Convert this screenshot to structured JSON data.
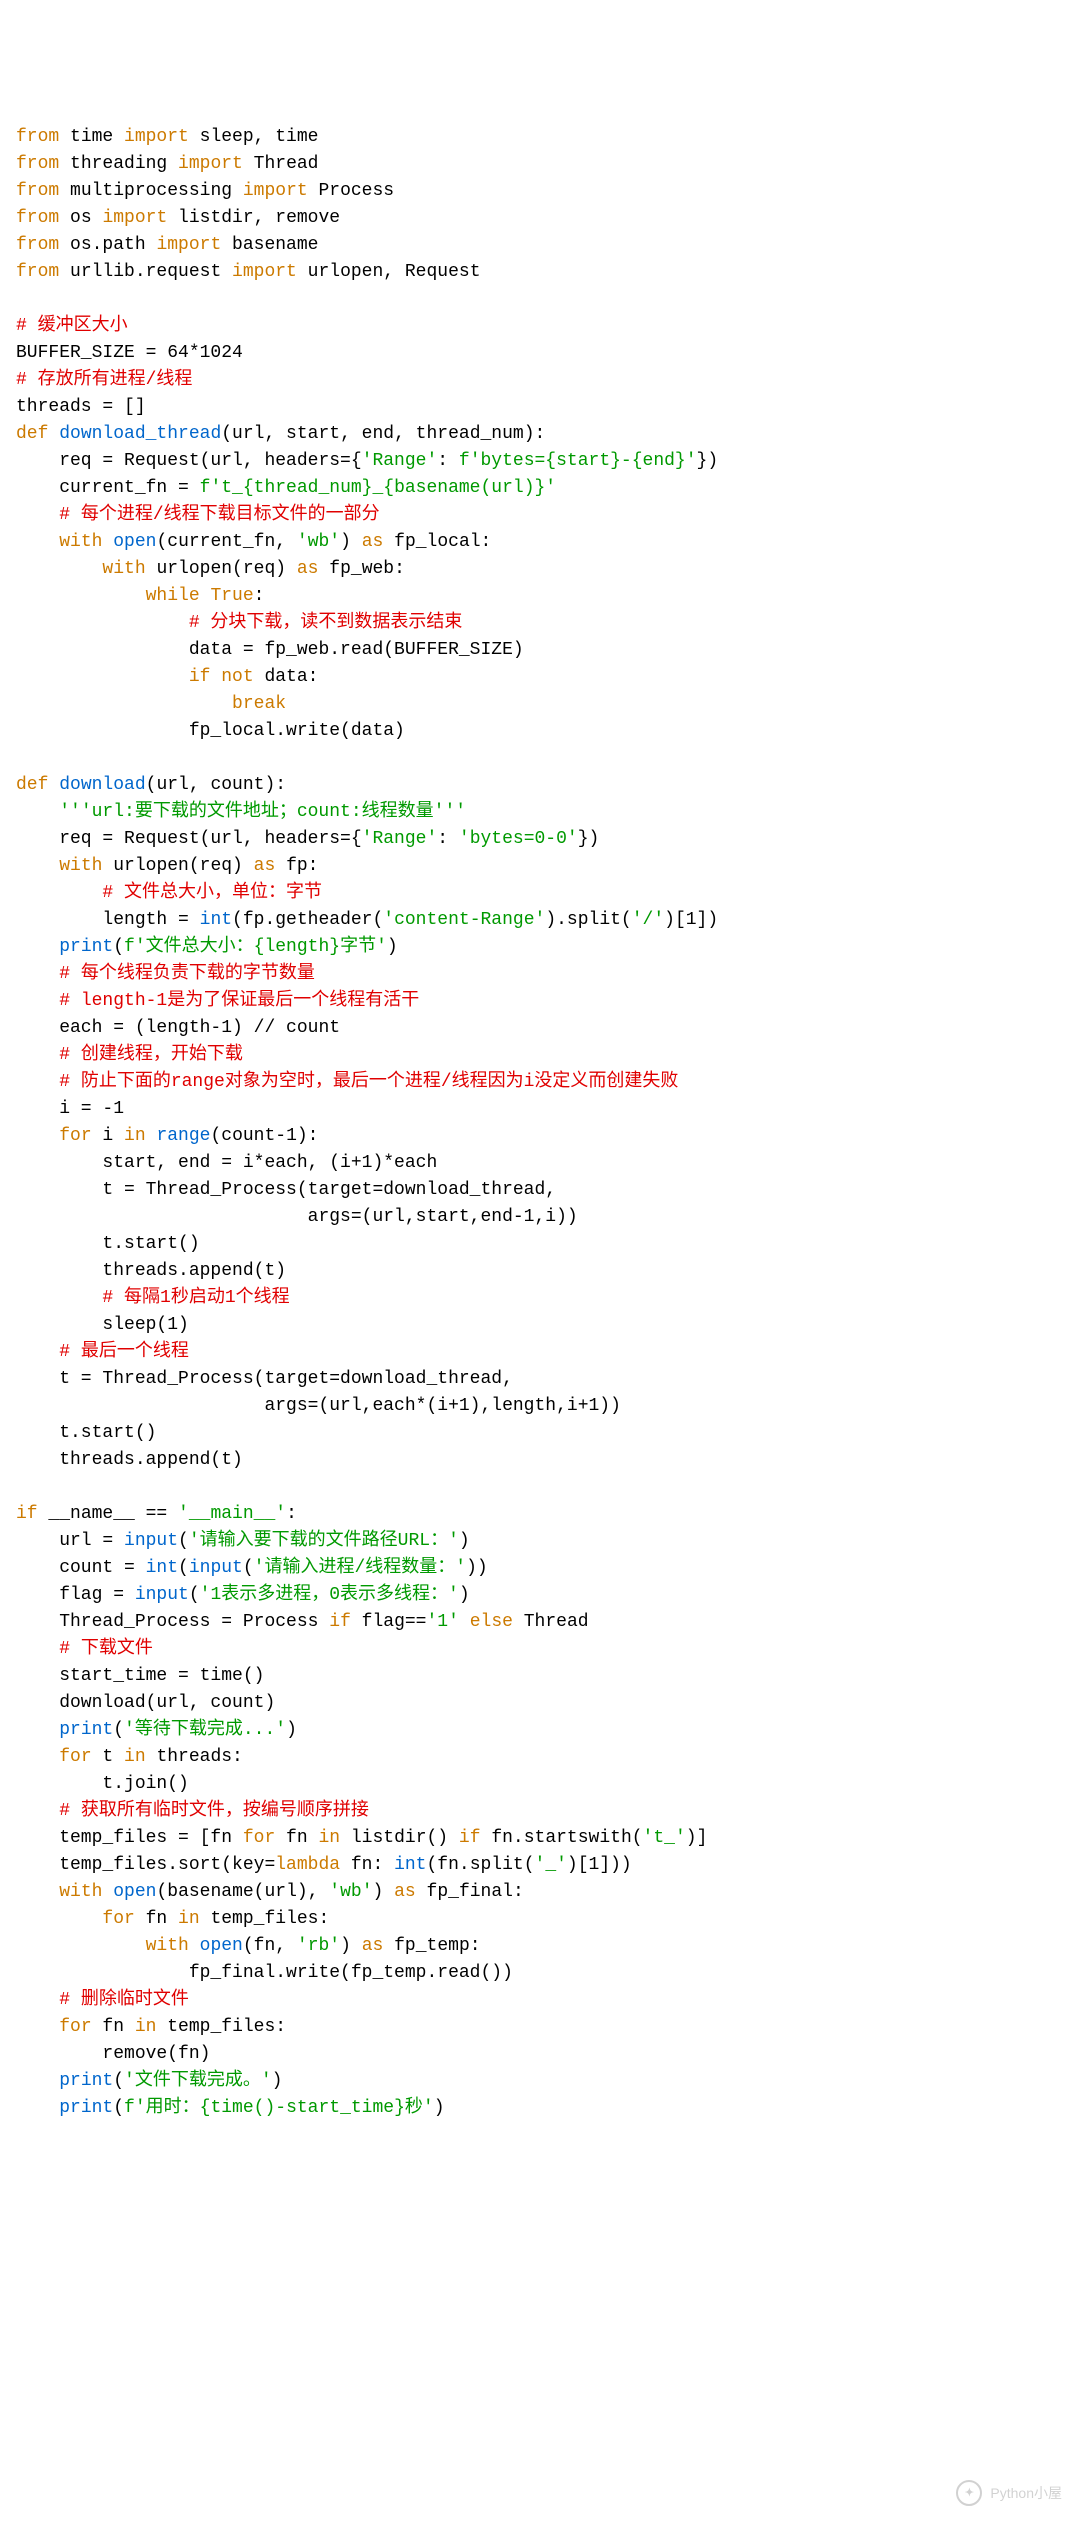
{
  "watermark": {
    "text": "Python小屋"
  },
  "code": {
    "tokens": [
      [
        [
          "kw",
          "from"
        ],
        [
          "dark",
          " time "
        ],
        [
          "kw",
          "import"
        ],
        [
          "dark",
          " sleep, time"
        ]
      ],
      [
        [
          "kw",
          "from"
        ],
        [
          "dark",
          " threading "
        ],
        [
          "kw",
          "import"
        ],
        [
          "dark",
          " Thread"
        ]
      ],
      [
        [
          "kw",
          "from"
        ],
        [
          "dark",
          " multiprocessing "
        ],
        [
          "kw",
          "import"
        ],
        [
          "dark",
          " Process"
        ]
      ],
      [
        [
          "kw",
          "from"
        ],
        [
          "dark",
          " os "
        ],
        [
          "kw",
          "import"
        ],
        [
          "dark",
          " listdir, remove"
        ]
      ],
      [
        [
          "kw",
          "from"
        ],
        [
          "dark",
          " os.path "
        ],
        [
          "kw",
          "import"
        ],
        [
          "dark",
          " basename"
        ]
      ],
      [
        [
          "kw",
          "from"
        ],
        [
          "dark",
          " urllib.request "
        ],
        [
          "kw",
          "import"
        ],
        [
          "dark",
          " urlopen, Request"
        ]
      ],
      [],
      [
        [
          "cmt",
          "# 缓冲区大小"
        ]
      ],
      [
        [
          "dark",
          "BUFFER_SIZE = 64*1024"
        ]
      ],
      [
        [
          "cmt",
          "# 存放所有进程/线程"
        ]
      ],
      [
        [
          "dark",
          "threads = []"
        ]
      ],
      [
        [
          "kw",
          "def "
        ],
        [
          "fn",
          "download_thread"
        ],
        [
          "dark",
          "(url, start, end, thread_num):"
        ]
      ],
      [
        [
          "dark",
          "    req = Request(url, headers={"
        ],
        [
          "str",
          "'Range'"
        ],
        [
          "dark",
          ": "
        ],
        [
          "str",
          "f'bytes={start}-{end}'"
        ],
        [
          "dark",
          "})"
        ]
      ],
      [
        [
          "dark",
          "    current_fn = "
        ],
        [
          "str",
          "f't_{thread_num}_{basename(url)}'"
        ]
      ],
      [
        [
          "dark",
          "    "
        ],
        [
          "cmt",
          "# 每个进程/线程下载目标文件的一部分"
        ]
      ],
      [
        [
          "dark",
          "    "
        ],
        [
          "kw",
          "with"
        ],
        [
          "dark",
          " "
        ],
        [
          "fn",
          "open"
        ],
        [
          "dark",
          "(current_fn, "
        ],
        [
          "str",
          "'wb'"
        ],
        [
          "dark",
          ") "
        ],
        [
          "kw",
          "as"
        ],
        [
          "dark",
          " fp_local:"
        ]
      ],
      [
        [
          "dark",
          "        "
        ],
        [
          "kw",
          "with"
        ],
        [
          "dark",
          " urlopen(req) "
        ],
        [
          "kw",
          "as"
        ],
        [
          "dark",
          " fp_web:"
        ]
      ],
      [
        [
          "dark",
          "            "
        ],
        [
          "kw",
          "while"
        ],
        [
          "dark",
          " "
        ],
        [
          "kw",
          "True"
        ],
        [
          "dark",
          ":"
        ]
      ],
      [
        [
          "dark",
          "                "
        ],
        [
          "cmt",
          "# 分块下载，读不到数据表示结束"
        ]
      ],
      [
        [
          "dark",
          "                data = fp_web.read(BUFFER_SIZE)"
        ]
      ],
      [
        [
          "dark",
          "                "
        ],
        [
          "kw",
          "if"
        ],
        [
          "dark",
          " "
        ],
        [
          "kw",
          "not"
        ],
        [
          "dark",
          " data:"
        ]
      ],
      [
        [
          "dark",
          "                    "
        ],
        [
          "kw",
          "break"
        ]
      ],
      [
        [
          "dark",
          "                fp_local.write(data)"
        ]
      ],
      [],
      [
        [
          "kw",
          "def "
        ],
        [
          "fn",
          "download"
        ],
        [
          "dark",
          "(url, count):"
        ]
      ],
      [
        [
          "dark",
          "    "
        ],
        [
          "str",
          "'''url:要下载的文件地址；count:线程数量'''"
        ]
      ],
      [
        [
          "dark",
          "    req = Request(url, headers={"
        ],
        [
          "str",
          "'Range'"
        ],
        [
          "dark",
          ": "
        ],
        [
          "str",
          "'bytes=0-0'"
        ],
        [
          "dark",
          "})"
        ]
      ],
      [
        [
          "dark",
          "    "
        ],
        [
          "kw",
          "with"
        ],
        [
          "dark",
          " urlopen(req) "
        ],
        [
          "kw",
          "as"
        ],
        [
          "dark",
          " fp:"
        ]
      ],
      [
        [
          "dark",
          "        "
        ],
        [
          "cmt",
          "# 文件总大小，单位：字节"
        ]
      ],
      [
        [
          "dark",
          "        length = "
        ],
        [
          "fn",
          "int"
        ],
        [
          "dark",
          "(fp.getheader("
        ],
        [
          "str",
          "'content-Range'"
        ],
        [
          "dark",
          ").split("
        ],
        [
          "str",
          "'/'"
        ],
        [
          "dark",
          ")[1])"
        ]
      ],
      [
        [
          "dark",
          "    "
        ],
        [
          "fn",
          "print"
        ],
        [
          "dark",
          "("
        ],
        [
          "str",
          "f'文件总大小：{length}字节'"
        ],
        [
          "dark",
          ")"
        ]
      ],
      [
        [
          "dark",
          "    "
        ],
        [
          "cmt",
          "# 每个线程负责下载的字节数量"
        ]
      ],
      [
        [
          "dark",
          "    "
        ],
        [
          "cmt",
          "# length-1是为了保证最后一个线程有活干"
        ]
      ],
      [
        [
          "dark",
          "    each = (length-1) // count"
        ]
      ],
      [
        [
          "dark",
          "    "
        ],
        [
          "cmt",
          "# 创建线程，开始下载"
        ]
      ],
      [
        [
          "dark",
          "    "
        ],
        [
          "cmt",
          "# 防止下面的range对象为空时，最后一个进程/线程因为i没定义而创建失败"
        ]
      ],
      [
        [
          "dark",
          "    i = -1"
        ]
      ],
      [
        [
          "dark",
          "    "
        ],
        [
          "kw",
          "for"
        ],
        [
          "dark",
          " i "
        ],
        [
          "kw",
          "in"
        ],
        [
          "dark",
          " "
        ],
        [
          "fn",
          "range"
        ],
        [
          "dark",
          "(count-1):"
        ]
      ],
      [
        [
          "dark",
          "        start, end = i*each, (i+1)*each"
        ]
      ],
      [
        [
          "dark",
          "        t = Thread_Process(target=download_thread,"
        ]
      ],
      [
        [
          "dark",
          "                           args=(url,start,end-1,i))"
        ]
      ],
      [
        [
          "dark",
          "        t.start()"
        ]
      ],
      [
        [
          "dark",
          "        threads.append(t)"
        ]
      ],
      [
        [
          "dark",
          "        "
        ],
        [
          "cmt",
          "# 每隔1秒启动1个线程"
        ]
      ],
      [
        [
          "dark",
          "        sleep(1)"
        ]
      ],
      [
        [
          "dark",
          "    "
        ],
        [
          "cmt",
          "# 最后一个线程"
        ]
      ],
      [
        [
          "dark",
          "    t = Thread_Process(target=download_thread,"
        ]
      ],
      [
        [
          "dark",
          "                       args=(url,each*(i+1),length,i+1))"
        ]
      ],
      [
        [
          "dark",
          "    t.start()"
        ]
      ],
      [
        [
          "dark",
          "    threads.append(t)"
        ]
      ],
      [],
      [
        [
          "kw",
          "if"
        ],
        [
          "dark",
          " __name__ == "
        ],
        [
          "str",
          "'__main__'"
        ],
        [
          "dark",
          ":"
        ]
      ],
      [
        [
          "dark",
          "    url = "
        ],
        [
          "fn",
          "input"
        ],
        [
          "dark",
          "("
        ],
        [
          "str",
          "'请输入要下载的文件路径URL：'"
        ],
        [
          "dark",
          ")"
        ]
      ],
      [
        [
          "dark",
          "    count = "
        ],
        [
          "fn",
          "int"
        ],
        [
          "dark",
          "("
        ],
        [
          "fn",
          "input"
        ],
        [
          "dark",
          "("
        ],
        [
          "str",
          "'请输入进程/线程数量：'"
        ],
        [
          "dark",
          "))"
        ]
      ],
      [
        [
          "dark",
          "    flag = "
        ],
        [
          "fn",
          "input"
        ],
        [
          "dark",
          "("
        ],
        [
          "str",
          "'1表示多进程，0表示多线程：'"
        ],
        [
          "dark",
          ")"
        ]
      ],
      [
        [
          "dark",
          "    Thread_Process = Process "
        ],
        [
          "kw",
          "if"
        ],
        [
          "dark",
          " flag=="
        ],
        [
          "str",
          "'1'"
        ],
        [
          "dark",
          " "
        ],
        [
          "kw",
          "else"
        ],
        [
          "dark",
          " Thread"
        ]
      ],
      [
        [
          "dark",
          "    "
        ],
        [
          "cmt",
          "# 下载文件"
        ]
      ],
      [
        [
          "dark",
          "    start_time = time()"
        ]
      ],
      [
        [
          "dark",
          "    download(url, count)"
        ]
      ],
      [
        [
          "dark",
          "    "
        ],
        [
          "fn",
          "print"
        ],
        [
          "dark",
          "("
        ],
        [
          "str",
          "'等待下载完成...'"
        ],
        [
          "dark",
          ")"
        ]
      ],
      [
        [
          "dark",
          "    "
        ],
        [
          "kw",
          "for"
        ],
        [
          "dark",
          " t "
        ],
        [
          "kw",
          "in"
        ],
        [
          "dark",
          " threads:"
        ]
      ],
      [
        [
          "dark",
          "        t.join()"
        ]
      ],
      [
        [
          "dark",
          "    "
        ],
        [
          "cmt",
          "# 获取所有临时文件，按编号顺序拼接"
        ]
      ],
      [
        [
          "dark",
          "    temp_files = [fn "
        ],
        [
          "kw",
          "for"
        ],
        [
          "dark",
          " fn "
        ],
        [
          "kw",
          "in"
        ],
        [
          "dark",
          " listdir() "
        ],
        [
          "kw",
          "if"
        ],
        [
          "dark",
          " fn.startswith("
        ],
        [
          "str",
          "'t_'"
        ],
        [
          "dark",
          ")]"
        ]
      ],
      [
        [
          "dark",
          "    temp_files.sort(key="
        ],
        [
          "kw",
          "lambda"
        ],
        [
          "dark",
          " fn: "
        ],
        [
          "fn",
          "int"
        ],
        [
          "dark",
          "(fn.split("
        ],
        [
          "str",
          "'_'"
        ],
        [
          "dark",
          ")[1]))"
        ]
      ],
      [
        [
          "dark",
          "    "
        ],
        [
          "kw",
          "with"
        ],
        [
          "dark",
          " "
        ],
        [
          "fn",
          "open"
        ],
        [
          "dark",
          "(basename(url), "
        ],
        [
          "str",
          "'wb'"
        ],
        [
          "dark",
          ") "
        ],
        [
          "kw",
          "as"
        ],
        [
          "dark",
          " fp_final:"
        ]
      ],
      [
        [
          "dark",
          "        "
        ],
        [
          "kw",
          "for"
        ],
        [
          "dark",
          " fn "
        ],
        [
          "kw",
          "in"
        ],
        [
          "dark",
          " temp_files:"
        ]
      ],
      [
        [
          "dark",
          "            "
        ],
        [
          "kw",
          "with"
        ],
        [
          "dark",
          " "
        ],
        [
          "fn",
          "open"
        ],
        [
          "dark",
          "(fn, "
        ],
        [
          "str",
          "'rb'"
        ],
        [
          "dark",
          ") "
        ],
        [
          "kw",
          "as"
        ],
        [
          "dark",
          " fp_temp:"
        ]
      ],
      [
        [
          "dark",
          "                fp_final.write(fp_temp.read())"
        ]
      ],
      [
        [
          "dark",
          "    "
        ],
        [
          "cmt",
          "# 删除临时文件"
        ]
      ],
      [
        [
          "dark",
          "    "
        ],
        [
          "kw",
          "for"
        ],
        [
          "dark",
          " fn "
        ],
        [
          "kw",
          "in"
        ],
        [
          "dark",
          " temp_files:"
        ]
      ],
      [
        [
          "dark",
          "        remove(fn)"
        ]
      ],
      [
        [
          "dark",
          "    "
        ],
        [
          "fn",
          "print"
        ],
        [
          "dark",
          "("
        ],
        [
          "str",
          "'文件下载完成。'"
        ],
        [
          "dark",
          ")"
        ]
      ],
      [
        [
          "dark",
          "    "
        ],
        [
          "fn",
          "print"
        ],
        [
          "dark",
          "("
        ],
        [
          "str",
          "f'用时：{time()-start_time}秒'"
        ],
        [
          "dark",
          ")"
        ]
      ]
    ]
  }
}
